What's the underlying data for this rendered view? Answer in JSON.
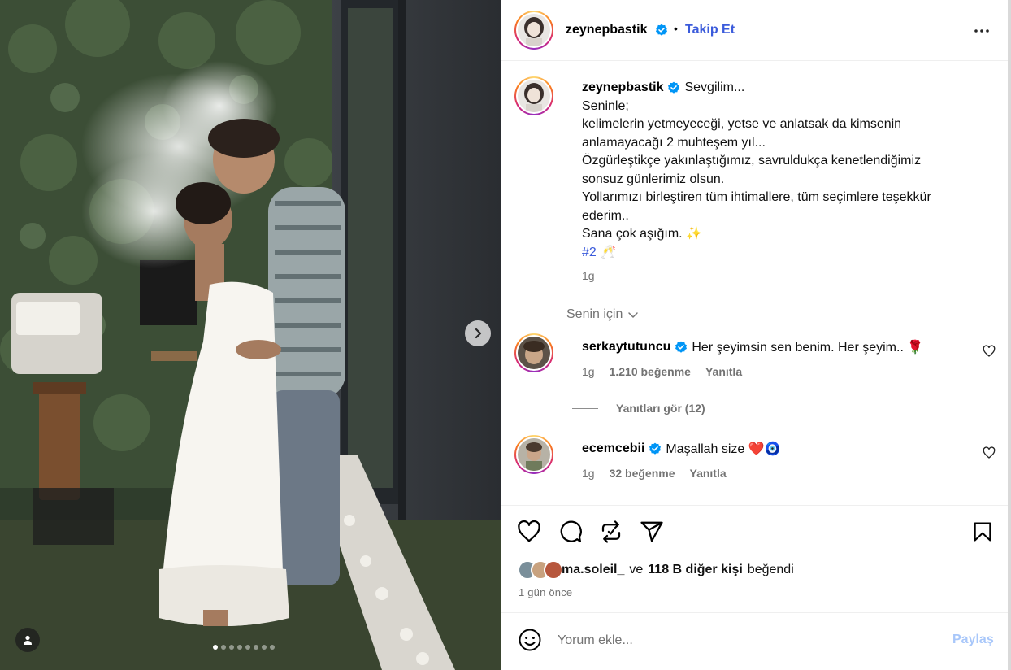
{
  "post": {
    "author": "zeynepbastik",
    "follow_label": "Takip Et",
    "separator": "•",
    "photo_alt": "Couple kissing in a garden",
    "carousel": {
      "total": 8,
      "active": 1
    }
  },
  "caption": {
    "author": "zeynepbastik",
    "lines": [
      "Sevgilim...",
      "Seninle;",
      "kelimelerin yetmeyeceği, yetse ve anlatsak da kimsenin",
      "anlamayacağı 2 muhteşem yıl...",
      "Özgürleştikçe yakınlaştığımız, savruldukça kenetlendiğimiz",
      "sonsuz günlerimiz olsun.",
      "Yollarımızı birleştiren tüm ihtimallere, tüm seçimlere teşekkür",
      "ederim..",
      "Sana çok aşığım. ✨"
    ],
    "hashtag": "#2",
    "hashtag_emoji": "🥂",
    "time": "1g"
  },
  "for_you_label": "Senin için",
  "comments": [
    {
      "author": "serkaytutuncu",
      "text": "Her şeyimsin sen benim. Her şeyim.. 🌹",
      "time": "1g",
      "likes": "1.210 beğenme",
      "reply_label": "Yanıtla"
    },
    {
      "author": "ecemcebii",
      "text": "Maşallah size ❤️🧿",
      "time": "1g",
      "likes": "32 beğenme",
      "reply_label": "Yanıtla"
    }
  ],
  "view_replies_label": "Yanıtları gör (12)",
  "likes_summary": {
    "first_user": "ma.soleil_",
    "conjunction": "ve",
    "others": "118 B diğer kişi",
    "suffix": "beğendi"
  },
  "post_time": "1 gün önce",
  "comment_box": {
    "placeholder": "Yorum ekle...",
    "share_label": "Paylaş"
  },
  "colors": {
    "link_blue": "#3b5bdb",
    "verified_blue": "#0095f6",
    "muted": "#737373",
    "share_disabled": "#a8c7fa"
  }
}
